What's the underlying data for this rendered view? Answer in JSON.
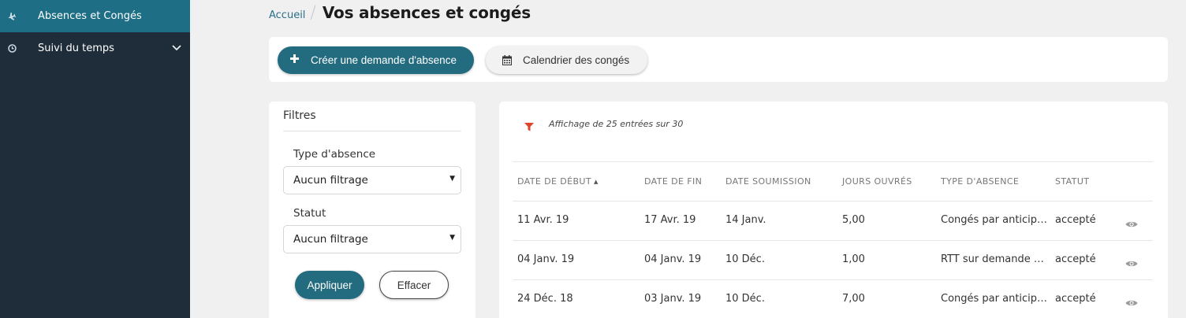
{
  "sidebar": {
    "items": [
      {
        "label": "Absences et Congés",
        "icon": "plane-icon",
        "active": true
      },
      {
        "label": "Suivi du temps",
        "icon": "clock-icon",
        "active": false,
        "expandable": true
      }
    ]
  },
  "breadcrumb": {
    "home": "Accueil",
    "separator": "/",
    "title": "Vos absences et congés"
  },
  "actions": {
    "create_label": "Créer une demande d'absence",
    "calendar_label": "Calendrier des congés"
  },
  "filters": {
    "title": "Filtres",
    "type_label": "Type d'absence",
    "type_value": "Aucun filtrage",
    "status_label": "Statut",
    "status_value": "Aucun filtrage",
    "apply_label": "Appliquer",
    "clear_label": "Effacer"
  },
  "results": {
    "summary": "Affichage de 25 entrées sur 30",
    "columns": [
      "DATE DE DÉBUT",
      "DATE DE FIN",
      "DATE SOUMISSION",
      "JOURS OUVRÉS",
      "TYPE D'ABSENCE",
      "STATUT"
    ],
    "sorted_column": "DATE DE DÉBUT",
    "sort_direction": "asc",
    "rows": [
      {
        "start": "11 Avr. 19",
        "end": "17 Avr. 19",
        "submitted": "14 Janv.",
        "days": "5,00",
        "type": "Congés par anticip…",
        "status": "accepté"
      },
      {
        "start": "04 Janv. 19",
        "end": "04 Janv. 19",
        "submitted": "10 Déc.",
        "days": "1,00",
        "type": "RTT sur demande …",
        "status": "accepté"
      },
      {
        "start": "24 Déc. 18",
        "end": "03 Janv. 19",
        "submitted": "10 Déc.",
        "days": "7,00",
        "type": "Congés par anticip…",
        "status": "accepté"
      }
    ]
  },
  "colors": {
    "sidebar_bg": "#1f2d3a",
    "sidebar_active": "#1e6f86",
    "primary": "#236b7e",
    "page_bg": "#f0f0f0",
    "filter_icon": "#e0452b"
  }
}
